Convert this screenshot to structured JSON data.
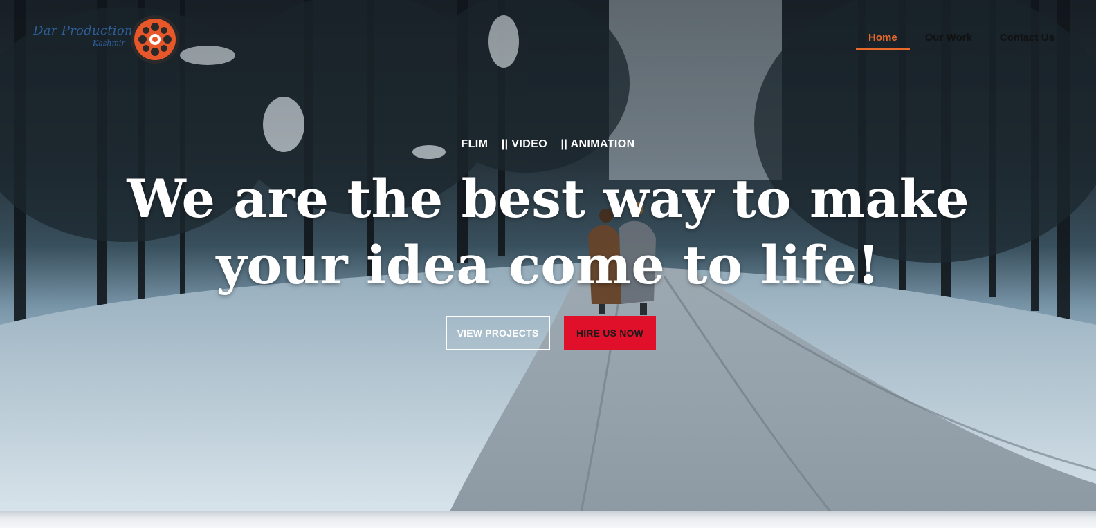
{
  "brand": {
    "logo_text": "Dar Production",
    "logo_sub": "Kashmir",
    "reel_icon": "film-reel-icon",
    "colors": {
      "reel": "#e8572a",
      "reel_dark": "#2a2a2a",
      "logo_text": "#2f5f9a"
    }
  },
  "nav": {
    "items": [
      {
        "label": "Home",
        "active": true
      },
      {
        "label": "Our Work",
        "active": false
      },
      {
        "label": "Contact Us",
        "active": false
      }
    ],
    "active_color": "#e8692a"
  },
  "hero": {
    "tagline": "FLIM    || VIDEO    || ANIMATION",
    "headline_line1": "We are the best way to make",
    "headline_line2": "your idea come to life!",
    "buttons": {
      "primary_outline": "VIEW PROJECTS",
      "primary_solid": "HIRE US NOW"
    },
    "colors": {
      "solid_button": "#e0102a"
    }
  }
}
